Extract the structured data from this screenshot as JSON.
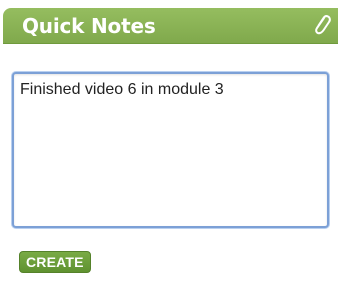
{
  "widget": {
    "title": "Quick Notes",
    "header_icon": "paperclip-icon",
    "note_text": "Finished video 6 in module 3",
    "create_label": "CREATE"
  },
  "colors": {
    "header_green": "#88b254",
    "button_green": "#6a9e38",
    "field_border": "#7ca0d6"
  }
}
